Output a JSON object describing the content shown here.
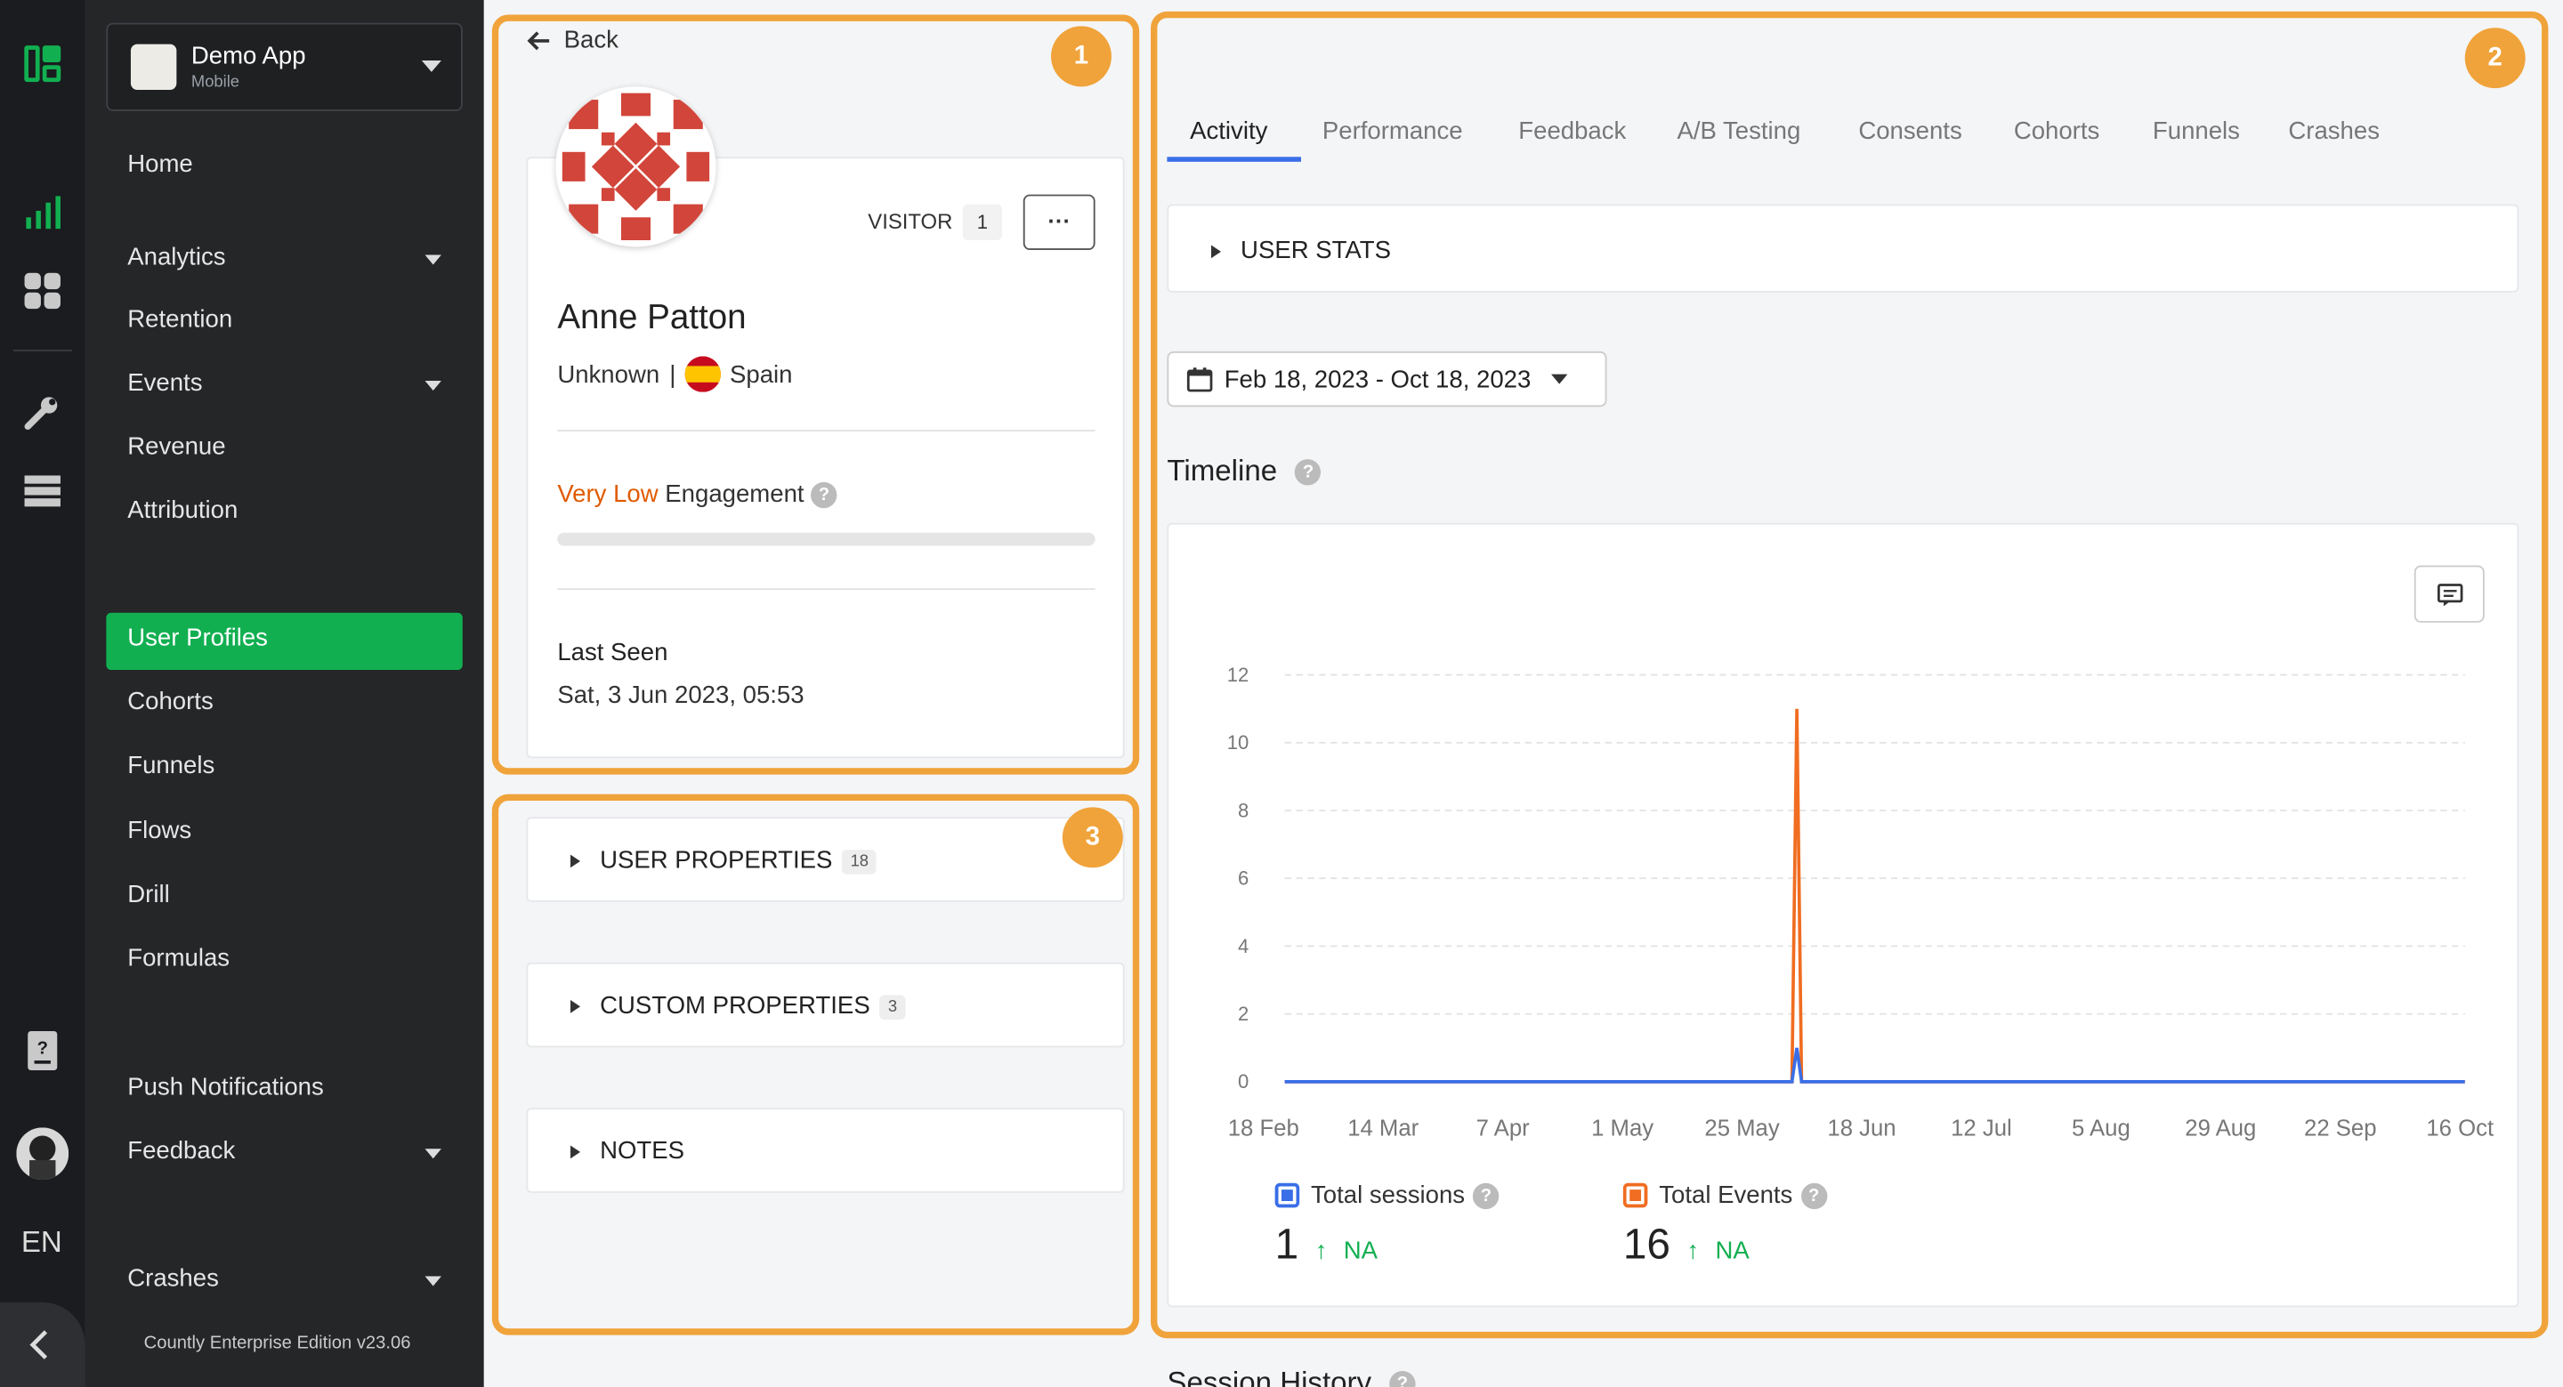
{
  "app": {
    "name": "Demo App",
    "platform": "Mobile",
    "language": "EN",
    "footer": "Countly Enterprise Edition v23.06"
  },
  "sidebar": {
    "items": [
      {
        "label": "Home",
        "top": 102,
        "caret": false
      },
      {
        "label": "Analytics",
        "top": 159,
        "caret": true
      },
      {
        "label": "Retention",
        "top": 197,
        "caret": false
      },
      {
        "label": "Events",
        "top": 236,
        "caret": true
      },
      {
        "label": "Revenue",
        "top": 275,
        "caret": false
      },
      {
        "label": "Attribution",
        "top": 314,
        "caret": false
      },
      {
        "label": "User Profiles",
        "top": 392,
        "caret": false,
        "active": true
      },
      {
        "label": "Cohorts",
        "top": 431,
        "caret": false
      },
      {
        "label": "Funnels",
        "top": 470,
        "caret": false
      },
      {
        "label": "Flows",
        "top": 510,
        "caret": false
      },
      {
        "label": "Drill",
        "top": 549,
        "caret": false
      },
      {
        "label": "Formulas",
        "top": 588,
        "caret": false
      },
      {
        "label": "Push Notifications",
        "top": 667,
        "caret": false
      },
      {
        "label": "Feedback",
        "top": 706,
        "caret": true
      },
      {
        "label": "Crashes",
        "top": 784,
        "caret": true
      }
    ]
  },
  "profile": {
    "back_label": "Back",
    "type_label": "VISITOR",
    "type_count": "1",
    "more_label": "···",
    "name": "Anne Patton",
    "gender": "Unknown",
    "separator": "|",
    "country": "Spain",
    "engagement_level": "Very Low",
    "engagement_label": "Engagement",
    "engagement_value": 0.0,
    "last_seen_label": "Last Seen",
    "last_seen_value": "Sat, 3 Jun 2023, 05:53"
  },
  "sections": {
    "user_properties": {
      "label": "USER PROPERTIES",
      "count": "18"
    },
    "custom_properties": {
      "label": "CUSTOM PROPERTIES",
      "count": "3"
    },
    "notes": {
      "label": "NOTES"
    }
  },
  "badges": {
    "one": "1",
    "two": "2",
    "three": "3"
  },
  "tabs": [
    "Activity",
    "Performance",
    "Feedback",
    "A/B Testing",
    "Consents",
    "Cohorts",
    "Funnels",
    "Crashes"
  ],
  "user_stats_label": "USER STATS",
  "date_range": "Feb 18, 2023 - Oct 18, 2023",
  "timeline": {
    "title": "Timeline",
    "help": "?"
  },
  "stats": {
    "sessions": {
      "label": "Total sessions",
      "value": "1",
      "change": "NA"
    },
    "events": {
      "label": "Total Events",
      "value": "16",
      "change": "NA"
    }
  },
  "session_history_label": "Session History",
  "colors": {
    "accent": "#12af51",
    "highlight": "#f0a33a",
    "sessions": "#3a6ee8",
    "events": "#f06d21",
    "low_engagement": "#e05a00"
  },
  "chart_data": {
    "type": "line",
    "x": [
      "18 Feb",
      "14 Mar",
      "7 Apr",
      "1 May",
      "25 May",
      "18 Jun",
      "12 Jul",
      "5 Aug",
      "29 Aug",
      "22 Sep",
      "16 Oct"
    ],
    "ylim": [
      0,
      12
    ],
    "yticks": [
      0,
      2,
      4,
      6,
      8,
      10,
      12
    ],
    "series": [
      {
        "name": "Total sessions",
        "points": [
          [
            "2023-02-18",
            0
          ],
          [
            "2023-06-02",
            0
          ],
          [
            "2023-06-03",
            1
          ],
          [
            "2023-06-04",
            0
          ],
          [
            "2023-10-18",
            0
          ]
        ]
      },
      {
        "name": "Total Events",
        "points": [
          [
            "2023-02-18",
            0
          ],
          [
            "2023-06-02",
            0
          ],
          [
            "2023-06-03",
            11
          ],
          [
            "2023-06-04",
            0
          ],
          [
            "2023-10-18",
            0
          ]
        ]
      }
    ]
  }
}
